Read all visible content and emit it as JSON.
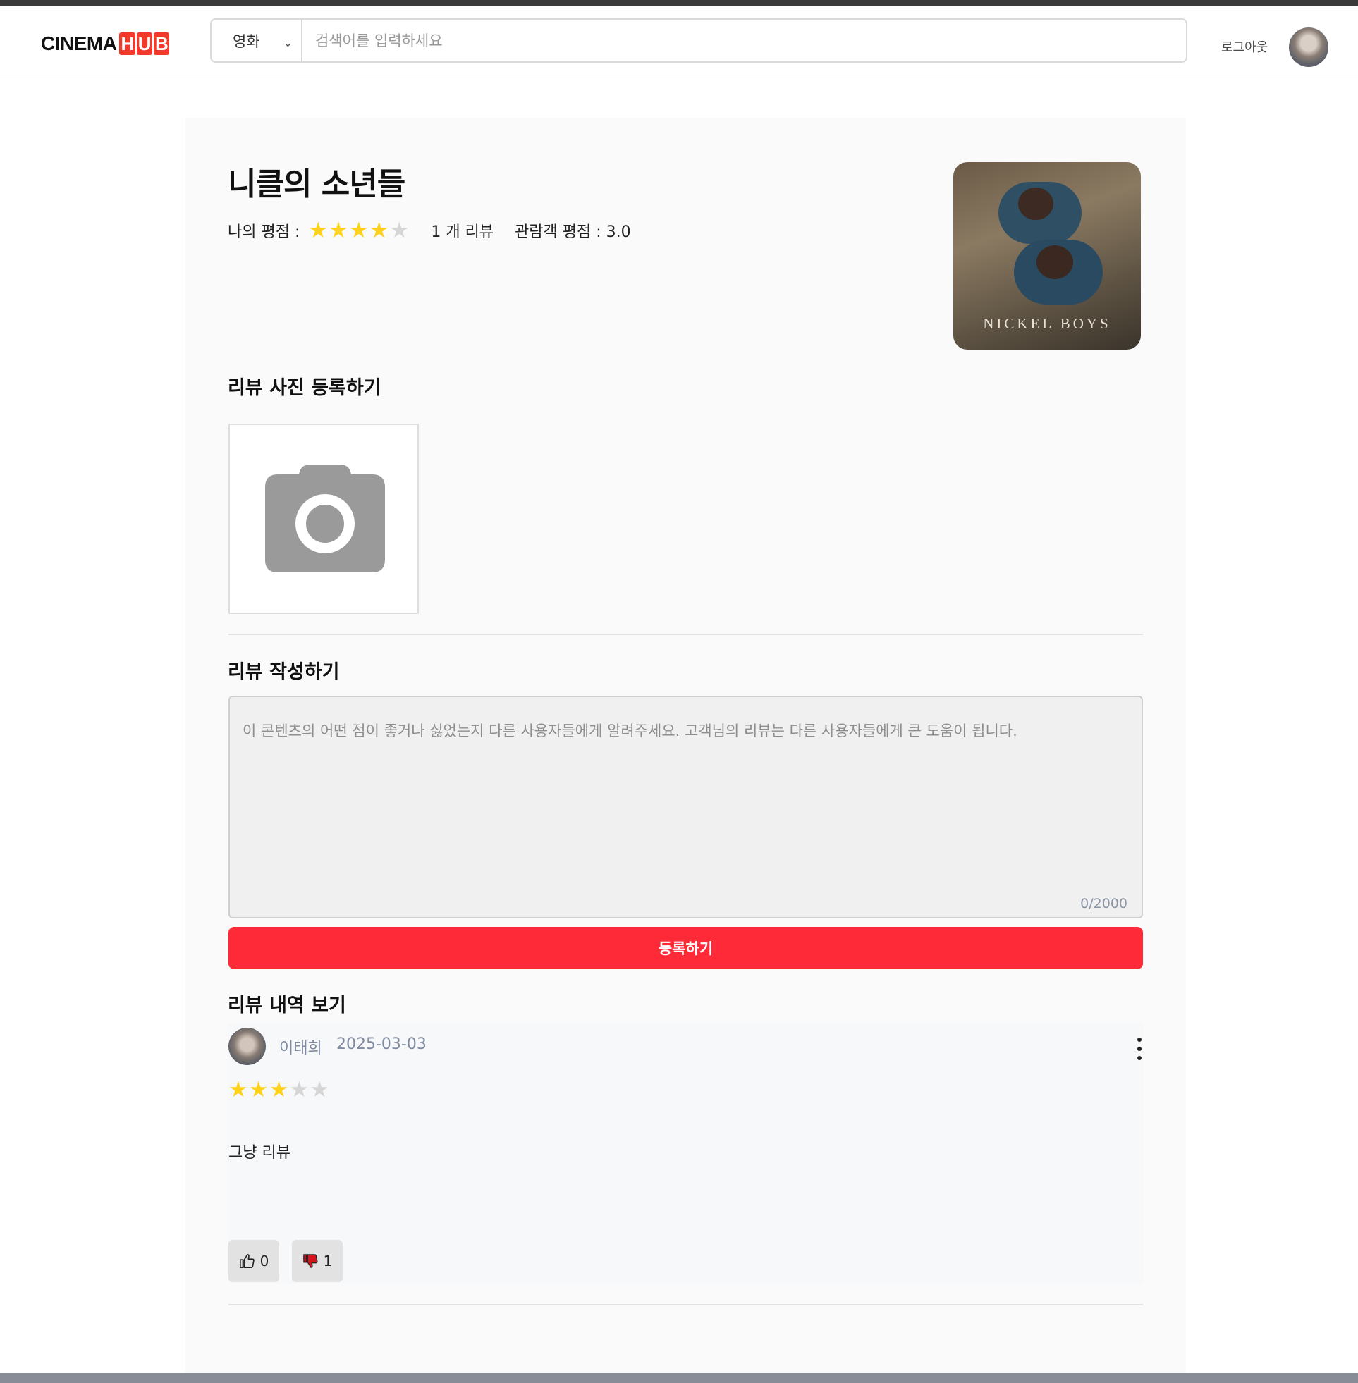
{
  "header": {
    "logo_prefix": "CINEMA",
    "logo_hub_letters": [
      "H",
      "U",
      "B"
    ],
    "search_category": "영화",
    "search_placeholder": "검색어를 입력하세요",
    "logout_label": "로그아웃"
  },
  "movie": {
    "title": "니클의 소년들",
    "my_rating_label": "나의 평점 :",
    "my_rating_value": 4,
    "rating_max": 5,
    "review_count_text": "1 개 리뷰",
    "audience_rating_text": "관람객 평점 : 3.0",
    "poster_title": "NICKEL BOYS"
  },
  "photo_section": {
    "label": "리뷰 사진 등록하기"
  },
  "write_section": {
    "label": "리뷰 작성하기",
    "textarea_placeholder": "이 콘텐츠의 어떤 점이 좋거나 싫었는지 다른 사용자들에게 알려주세요. 고객님의 리뷰는 다른 사용자들에게 큰 도움이 됩니다.",
    "counter": "0/2000",
    "submit_label": "등록하기"
  },
  "history_section": {
    "label": "리뷰 내역 보기",
    "reviews": [
      {
        "user": "이태희",
        "date": "2025-03-03",
        "rating": 3,
        "text": "그냥 리뷰",
        "likes": "0",
        "dislikes": "1"
      }
    ]
  },
  "colors": {
    "accent": "#ff2a38",
    "star_on": "#ffd11a",
    "star_off": "#d6d6d6"
  }
}
